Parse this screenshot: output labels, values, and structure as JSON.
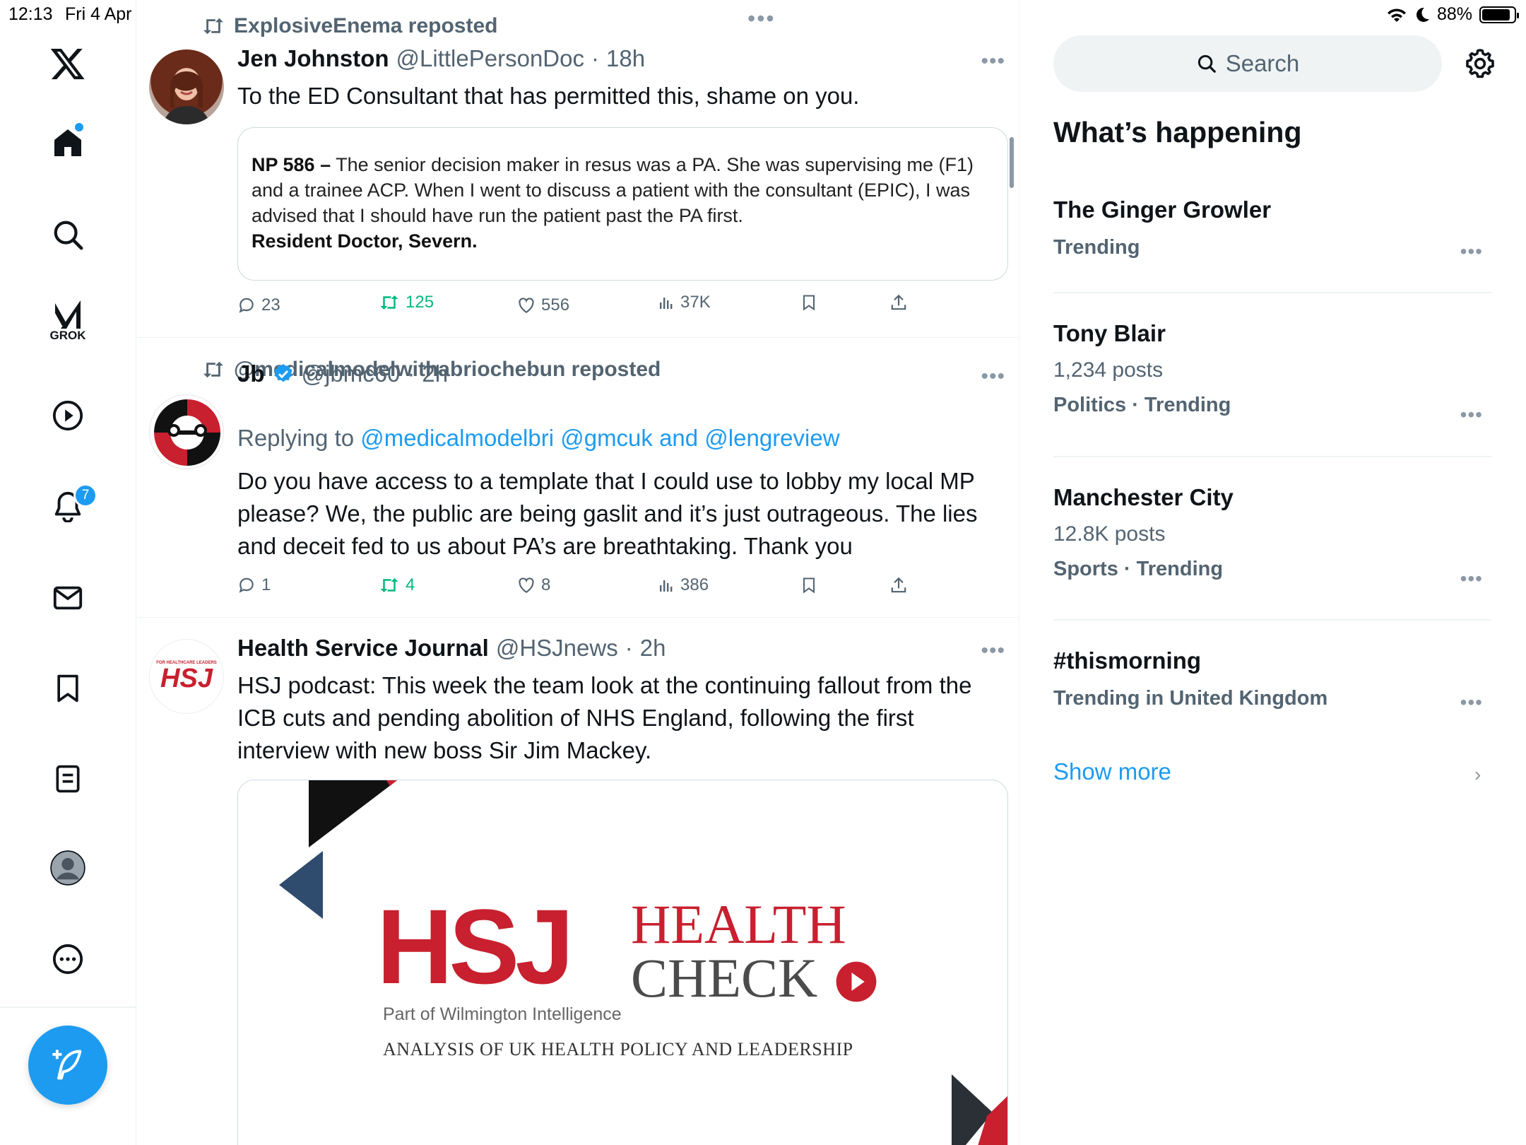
{
  "status_bar": {
    "time": "12:13",
    "date": "Fri 4 Apr",
    "battery": "88%",
    "battery_level": 0.88
  },
  "nav": {
    "grok_label": "GROK",
    "notifications_count": "7"
  },
  "feed": {
    "tweets": [
      {
        "repost_by": "ExplosiveEnema reposted",
        "name": "Jen Johnston",
        "handle": "@LittlePersonDoc",
        "dot": "·",
        "time": "18h",
        "text": "To the ED Consultant that has permitted this, shame on you.",
        "quote": {
          "prefix": "NP 586 –",
          "body": " The senior decision maker in resus was a PA. She was supervising me (F1) and a trainee ACP. When I went to discuss a patient with the consultant (EPIC), I was advised that I should have run the patient past the PA first.",
          "signoff": "Resident Doctor, Severn."
        },
        "replies": "23",
        "reposts": "125",
        "likes": "556",
        "views": "37K"
      },
      {
        "repost_by": "@medicalmodelwithabriochebun reposted",
        "name": "Jb",
        "handle": "@jbmc60",
        "dot": "·",
        "time": "2h",
        "replying_prefix": "Replying to",
        "replying_to": "@medicalmodelbri @gmcuk and @lengreview",
        "text": "Do you have access to a template that I could use to lobby my local MP please? We, the public are being gaslit and it’s just outrageous. The lies and deceit fed to us about PA’s are breathtaking. Thank you",
        "replies": "1",
        "reposts": "4",
        "likes": "8",
        "views": "386"
      },
      {
        "name": "Health Service Journal",
        "handle": "@HSJnews",
        "dot": "·",
        "time": "2h",
        "text": "HSJ podcast: This week the team look at the continuing fallout from the ICB cuts and pending abolition of NHS England, following the first interview with new boss Sir Jim Mackey.",
        "avatar_small": "FOR HEALTHCARE LEADERS",
        "avatar_logo": "HSJ",
        "media": {
          "logo": "HSJ",
          "title_line1": "HEALTH",
          "title_line2": "CHECK",
          "part_of": "Part of Wilmington Intelligence",
          "tagline": "ANALYSIS OF UK HEALTH POLICY AND LEADERSHIP"
        }
      }
    ]
  },
  "sidebar": {
    "search_placeholder": "Search",
    "section_title": "What’s happening",
    "trends": [
      {
        "title": "The Ginger Growler",
        "posts": "",
        "meta": "Trending"
      },
      {
        "title": "Tony Blair",
        "posts": "1,234 posts",
        "meta": "Politics · Trending"
      },
      {
        "title": "Manchester City",
        "posts": "12.8K posts",
        "meta": "Sports · Trending"
      },
      {
        "title": "#thismorning",
        "posts": "",
        "meta": "Trending in United Kingdom"
      }
    ],
    "show_more": "Show more",
    "more_glyph": "•••"
  },
  "colors": {
    "accent": "#1d9bf0",
    "repost_green": "#00ba7c",
    "hsj_red": "#c8202f",
    "hsj_navy": "#2f4b6e"
  }
}
